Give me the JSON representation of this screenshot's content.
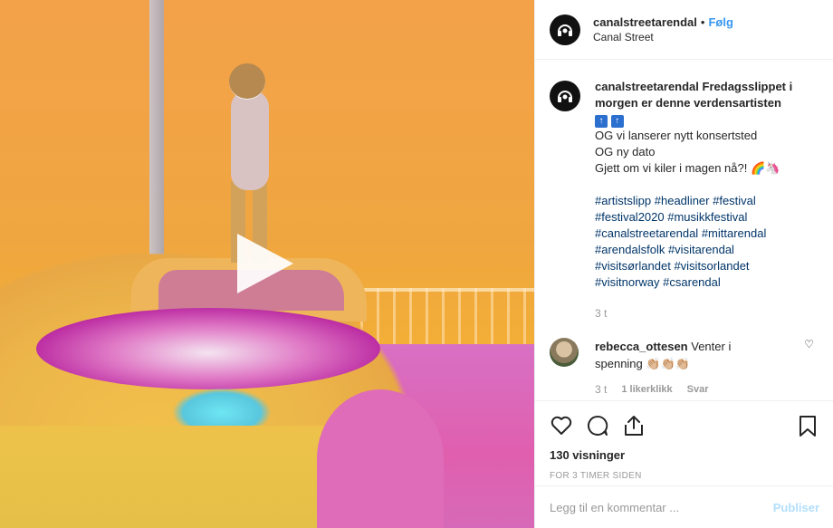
{
  "header": {
    "username": "canalstreetarendal",
    "separator": "•",
    "follow_label": "Følg",
    "location": "Canal Street"
  },
  "caption": {
    "username": "canalstreetarendal",
    "text": "Fredagsslippet i morgen er denne verdensartisten",
    "emojis": [
      "↑",
      "↑"
    ],
    "lines": [
      "OG vi lanserer nytt konsertsted",
      "OG ny dato",
      "Gjett om vi kiler i magen nå?! 🌈🦄"
    ],
    "hashtags": [
      "#artistslipp",
      "#headliner",
      "#festival",
      "#festival2020",
      "#musikkfestival",
      "#canalstreetarendal",
      "#mittarendal",
      "#arendalsfolk",
      "#visitarendal",
      "#visitsørlandet",
      "#visitsorlandet",
      "#visitnorway",
      "#csarendal"
    ],
    "time": "3 t"
  },
  "reply": {
    "username": "rebecca_ottesen",
    "text": "Venter i spenning 👏🏼👏🏼👏🏼",
    "time": "3 t",
    "likes": "1 likerklikk",
    "reply_label": "Svar"
  },
  "stats": {
    "views": "130 visninger",
    "ago": "FOR 3 TIMER SIDEN"
  },
  "comment_box": {
    "placeholder": "Legg til en kommentar ...",
    "post_label": "Publiser"
  },
  "colors": {
    "link": "#3897f0",
    "hashtag": "#003569",
    "muted": "#999999"
  }
}
